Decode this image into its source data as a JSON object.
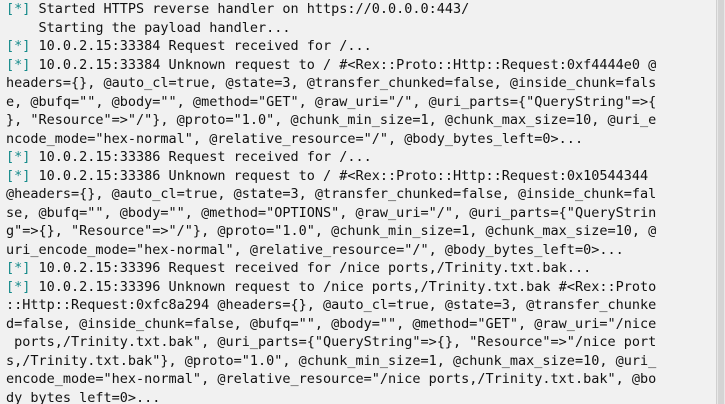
{
  "terminal": {
    "status_prefix": "[*]",
    "colors": {
      "background": "#f1f1f1",
      "text": "#111111",
      "status_prefix": "#148a8a"
    },
    "lines": [
      {
        "status": "[*]",
        "text": " Started HTTPS reverse handler on https://0.0.0.0:443/"
      },
      {
        "status": "",
        "text": "    Starting the payload handler..."
      },
      {
        "status": "[*]",
        "text": " 10.0.2.15:33384 Request received for /..."
      },
      {
        "status": "[*]",
        "text": " 10.0.2.15:33384 Unknown request to / #<Rex::Proto::Http::Request:0xf4444e0 @"
      },
      {
        "status": "",
        "text": "headers={}, @auto_cl=true, @state=3, @transfer_chunked=false, @inside_chunk=fals"
      },
      {
        "status": "",
        "text": "e, @bufq=\"\", @body=\"\", @method=\"GET\", @raw_uri=\"/\", @uri_parts={\"QueryString\"=>{"
      },
      {
        "status": "",
        "text": "}, \"Resource\"=>\"/\"}, @proto=\"1.0\", @chunk_min_size=1, @chunk_max_size=10, @uri_e"
      },
      {
        "status": "",
        "text": "ncode_mode=\"hex-normal\", @relative_resource=\"/\", @body_bytes_left=0>..."
      },
      {
        "status": "[*]",
        "text": " 10.0.2.15:33386 Request received for /..."
      },
      {
        "status": "[*]",
        "text": " 10.0.2.15:33386 Unknown request to / #<Rex::Proto::Http::Request:0x10544344"
      },
      {
        "status": "",
        "text": "@headers={}, @auto_cl=true, @state=3, @transfer_chunked=false, @inside_chunk=fal"
      },
      {
        "status": "",
        "text": "se, @bufq=\"\", @body=\"\", @method=\"OPTIONS\", @raw_uri=\"/\", @uri_parts={\"QueryStrin"
      },
      {
        "status": "",
        "text": "g\"=>{}, \"Resource\"=>\"/\"}, @proto=\"1.0\", @chunk_min_size=1, @chunk_max_size=10, @"
      },
      {
        "status": "",
        "text": "uri_encode_mode=\"hex-normal\", @relative_resource=\"/\", @body_bytes_left=0>..."
      },
      {
        "status": "[*]",
        "text": " 10.0.2.15:33396 Request received for /nice ports,/Trinity.txt.bak..."
      },
      {
        "status": "[*]",
        "text": " 10.0.2.15:33396 Unknown request to /nice ports,/Trinity.txt.bak #<Rex::Proto"
      },
      {
        "status": "",
        "text": "::Http::Request:0xfc8a294 @headers={}, @auto_cl=true, @state=3, @transfer_chunke"
      },
      {
        "status": "",
        "text": "d=false, @inside_chunk=false, @bufq=\"\", @body=\"\", @method=\"GET\", @raw_uri=\"/nice"
      },
      {
        "status": "",
        "text": " ports,/Trinity.txt.bak\", @uri_parts={\"QueryString\"=>{}, \"Resource\"=>\"/nice port"
      },
      {
        "status": "",
        "text": "s,/Trinity.txt.bak\"}, @proto=\"1.0\", @chunk_min_size=1, @chunk_max_size=10, @uri_"
      },
      {
        "status": "",
        "text": "encode_mode=\"hex-normal\", @relative_resource=\"/nice ports,/Trinity.txt.bak\", @bo"
      },
      {
        "status": "",
        "text": "dy_bytes_left=0>..."
      }
    ]
  }
}
